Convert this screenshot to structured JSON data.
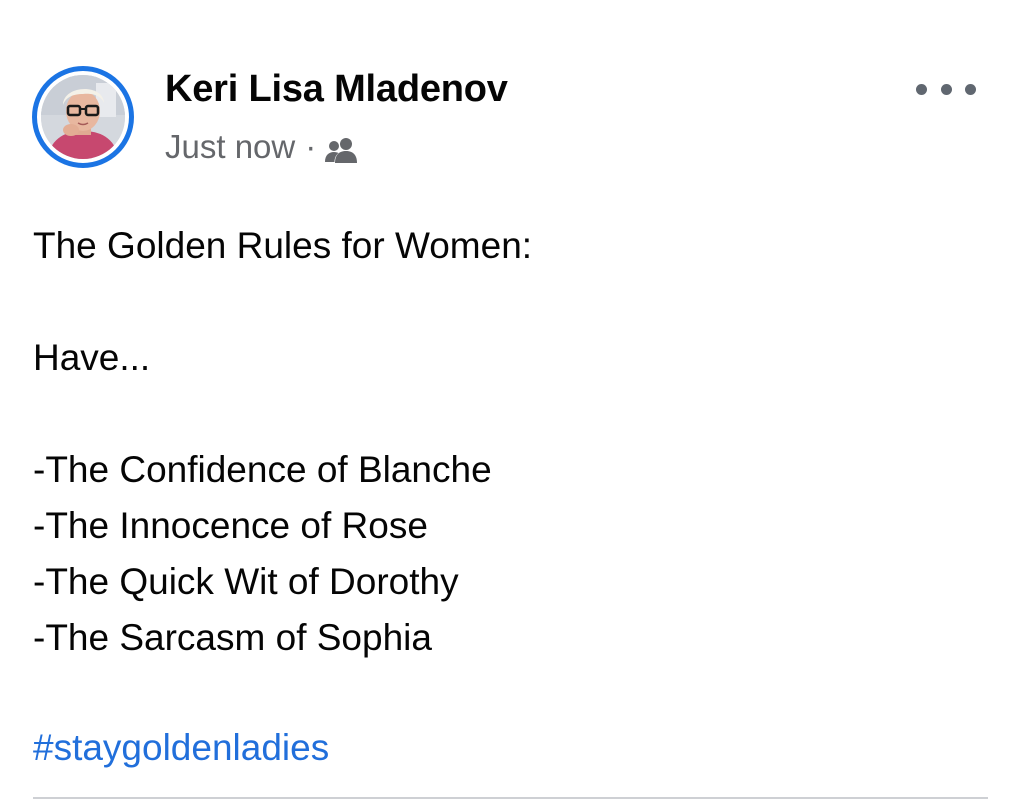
{
  "post": {
    "author": "Keri Lisa Mladenov",
    "timestamp": "Just now",
    "separator": "·",
    "audience_icon": "friends-icon",
    "more_icon": "more-options-icon",
    "accent_color": "#1b74e4",
    "lines": [
      "The Golden Rules for Women:",
      "",
      "Have...",
      "",
      "-The Confidence of Blanche",
      "-The Innocence of Rose",
      "-The Quick Wit of Dorothy",
      "-The Sarcasm of Sophia"
    ],
    "hashtag": "#staygoldenladies"
  }
}
